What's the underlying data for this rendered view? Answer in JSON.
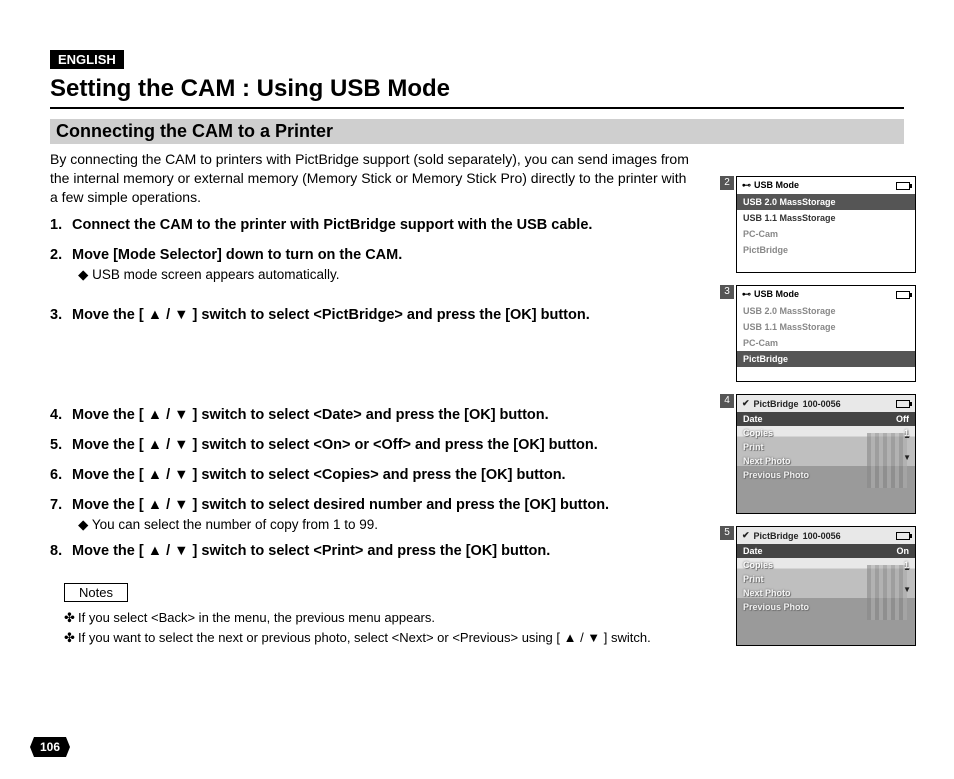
{
  "lang": "ENGLISH",
  "title": "Setting the CAM : Using USB Mode",
  "subtitle": "Connecting the CAM to a Printer",
  "intro": "By connecting the CAM to printers with PictBridge support (sold separately), you can send images from the internal memory or external memory (Memory Stick or Memory Stick Pro) directly to the printer with a few simple operations.",
  "steps": {
    "s1": "Connect the CAM to the printer with PictBridge support with the USB cable.",
    "s2": "Move [Mode Selector] down to turn on the CAM.",
    "s2sub": "◆ USB mode screen appears automatically.",
    "s3": "Move the [ ▲ / ▼ ] switch to select <PictBridge> and press the [OK] button.",
    "s4": "Move the [ ▲ / ▼ ] switch to select <Date> and press the [OK] button.",
    "s5": "Move the [ ▲ / ▼ ] switch to select <On> or <Off> and press the [OK] button.",
    "s6": "Move the [ ▲ / ▼ ] switch to select <Copies> and press the [OK] button.",
    "s7": "Move the [ ▲ / ▼ ] switch to select desired number and press the [OK] button.",
    "s7sub": "◆ You can select the number of copy from 1 to 99.",
    "s8": "Move the [ ▲ / ▼ ] switch to select <Print> and press the [OK] button."
  },
  "notes_label": "Notes",
  "notes": {
    "n1": "If you select <Back> in the menu, the previous menu appears.",
    "n2": "If you want to select the next or previous photo, select <Next> or <Previous> using [ ▲ / ▼ ] switch."
  },
  "page_number": "106",
  "screens": {
    "s2": {
      "tag": "2",
      "header": "USB Mode",
      "items": [
        "USB 2.0 MassStorage",
        "USB 1.1 MassStorage",
        "PC-Cam",
        "PictBridge"
      ],
      "selected_index": 0
    },
    "s3": {
      "tag": "3",
      "header": "USB Mode",
      "items": [
        "USB 2.0 MassStorage",
        "USB 1.1 MassStorage",
        "PC-Cam",
        "PictBridge"
      ],
      "selected_index": 3
    },
    "s4": {
      "tag": "4",
      "header_left": "PictBridge",
      "header_right": "100-0056",
      "rows": [
        {
          "label": "Date",
          "value": "Off",
          "sel": true
        },
        {
          "label": "Copies",
          "value": "1"
        },
        {
          "label": "Print",
          "value": ""
        },
        {
          "label": "Next Photo",
          "value": ""
        },
        {
          "label": "Previous Photo",
          "value": ""
        }
      ]
    },
    "s5": {
      "tag": "5",
      "header_left": "PictBridge",
      "header_right": "100-0056",
      "rows": [
        {
          "label": "Date",
          "value": "On",
          "sel": true
        },
        {
          "label": "Copies",
          "value": "1"
        },
        {
          "label": "Print",
          "value": ""
        },
        {
          "label": "Next Photo",
          "value": ""
        },
        {
          "label": "Previous Photo",
          "value": ""
        }
      ]
    }
  }
}
